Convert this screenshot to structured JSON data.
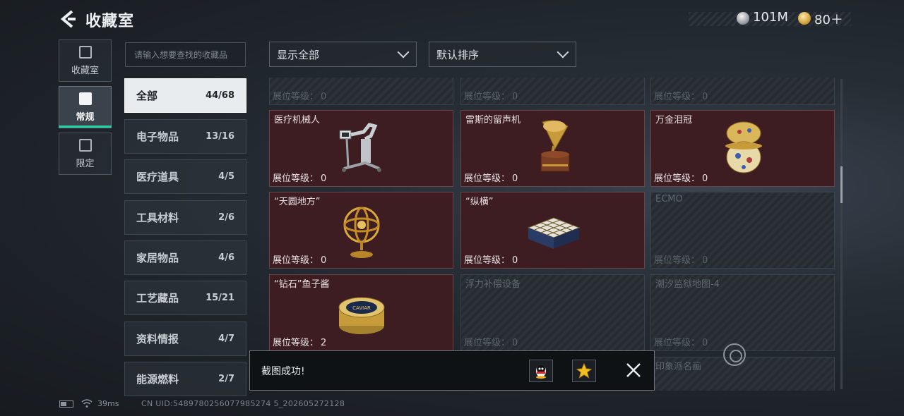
{
  "header": {
    "title": "收藏室",
    "currency": [
      {
        "icon": "silver-coin-icon",
        "value": "101M"
      },
      {
        "icon": "gold-coin-icon",
        "value": "80＋"
      }
    ]
  },
  "side_tabs": [
    {
      "label": "收藏室",
      "icon": "vault-icon",
      "active": false
    },
    {
      "label": "常规",
      "icon": "gallery-icon",
      "active": true
    },
    {
      "label": "限定",
      "icon": "limited-icon",
      "active": false
    }
  ],
  "search": {
    "placeholder": "请输入想要查找的收藏品"
  },
  "categories": [
    {
      "name": "全部",
      "count": "44/68",
      "active": true
    },
    {
      "name": "电子物品",
      "count": "13/16"
    },
    {
      "name": "医疗道具",
      "count": "4/5"
    },
    {
      "name": "工具材料",
      "count": "2/6"
    },
    {
      "name": "家居物品",
      "count": "4/6"
    },
    {
      "name": "工艺藏品",
      "count": "15/21"
    },
    {
      "name": "资料情报",
      "count": "4/7"
    },
    {
      "name": "能源燃料",
      "count": "2/7"
    }
  ],
  "filters": {
    "filter_label": "显示全部",
    "sort_label": "默认排序"
  },
  "level_label": "展位等级：",
  "items": [
    {
      "name": "",
      "level": "0",
      "owned": false
    },
    {
      "name": "",
      "level": "0",
      "owned": false
    },
    {
      "name": "",
      "level": "0",
      "owned": false
    },
    {
      "name": "医疗机械人",
      "level": "0",
      "owned": true,
      "icon": "medical-robot-icon"
    },
    {
      "name": "雷斯的留声机",
      "level": "0",
      "owned": true,
      "icon": "gramophone-icon"
    },
    {
      "name": "万金泪冠",
      "level": "0",
      "owned": true,
      "icon": "jeweled-egg-icon"
    },
    {
      "name": "“天圆地方”",
      "level": "0",
      "owned": true,
      "icon": "armillary-sphere-icon"
    },
    {
      "name": "“纵横”",
      "level": "0",
      "owned": true,
      "icon": "chess-set-icon"
    },
    {
      "name": "ECMO",
      "level": "0",
      "owned": false
    },
    {
      "name": "“钻石”鱼子酱",
      "level": "2",
      "owned": true,
      "icon": "caviar-tin-icon",
      "art_text": "CAVIAR"
    },
    {
      "name": "浮力补偿设备",
      "level": "0",
      "owned": false
    },
    {
      "name": "潮汐监狱地图-4",
      "level": "0",
      "owned": false
    },
    {
      "name": "",
      "level": "",
      "owned": false
    },
    {
      "name": "",
      "level": "",
      "owned": false
    },
    {
      "name": "印象派名画",
      "level": "",
      "owned": false
    }
  ],
  "toast": {
    "message": "截图成功!"
  },
  "footer": {
    "ping": "39ms",
    "uid": "CN UID:5489780256077985274 5_202605272128"
  },
  "colors": {
    "accent": "#1fd3a6",
    "owned_card": "#3d1d22"
  }
}
